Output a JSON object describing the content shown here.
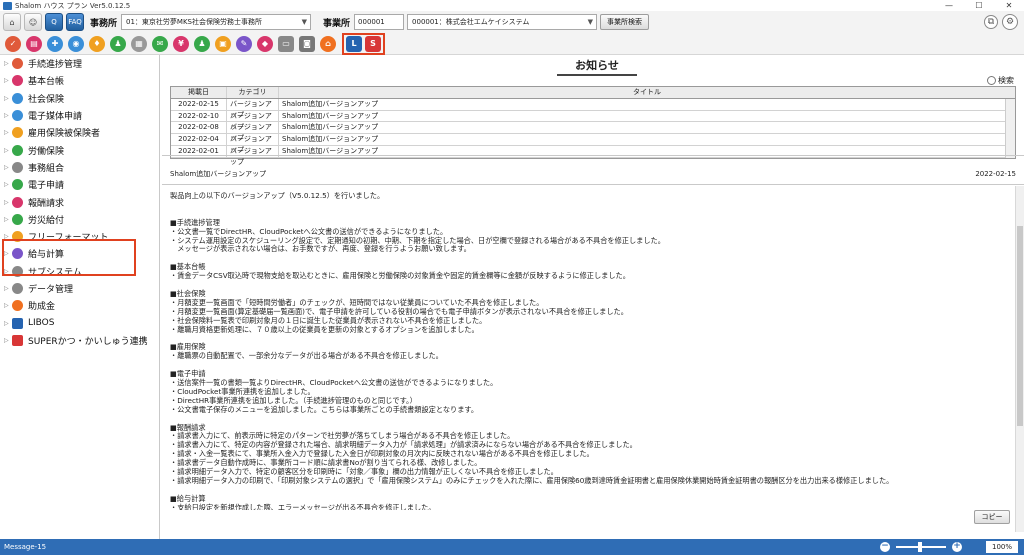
{
  "window": {
    "title": "Shalom ハウス プラン Ver5.0.12.5"
  },
  "toolbar": {
    "jimusho_label": "事務所",
    "jimusho_select": "01：東京社労夢MKS社会保険労務士事務所",
    "jigyosho_label": "事業所",
    "jigyosho_code": "000001",
    "jigyosho_select": "000001：株式会社エムケイシステム",
    "search_button": "事業所検索",
    "q_label": "Q",
    "faq_label": "FAQ"
  },
  "icon_toolbar": {
    "highlighted": [
      "L",
      "S"
    ]
  },
  "sidebar": {
    "items": [
      {
        "label": "手続進捗管理",
        "icon_color": "#e05a3a"
      },
      {
        "label": "基本台帳",
        "icon_color": "#d8366b"
      },
      {
        "label": "社会保険",
        "icon_color": "#3a8fd8"
      },
      {
        "label": "電子媒体申請",
        "icon_color": "#3a8fd8"
      },
      {
        "label": "雇用保険被保険者",
        "icon_color": "#f0a020"
      },
      {
        "label": "労働保険",
        "icon_color": "#37a84a"
      },
      {
        "label": "事務組合",
        "icon_color": "#888888"
      },
      {
        "label": "電子申請",
        "icon_color": "#37a84a"
      },
      {
        "label": "報酬請求",
        "icon_color": "#d8366b"
      },
      {
        "label": "労災給付",
        "icon_color": "#37a84a"
      },
      {
        "label": "フリーフォーマット",
        "icon_color": "#f0a020"
      },
      {
        "label": "給与計算",
        "icon_color": "#7a55c9"
      },
      {
        "label": "サブシステム",
        "icon_color": "#888888"
      },
      {
        "label": "データ管理",
        "icon_color": "#888888"
      },
      {
        "label": "助成金",
        "icon_color": "#f07020"
      },
      {
        "label": "LIBOS",
        "icon_color": "#2563b0"
      },
      {
        "label": "SUPERかつ・かいしゅう連携",
        "icon_color": "#d83636"
      }
    ]
  },
  "main": {
    "title": "お知らせ",
    "search_label": "検索",
    "table": {
      "headers": [
        "掲載日",
        "カテゴリ",
        "タイトル"
      ],
      "rows": [
        [
          "2022-02-15",
          "バージョンアップ",
          "Shalom追加バージョンアップ"
        ],
        [
          "2022-02-10",
          "バージョンアップ",
          "Shalom追加バージョンアップ"
        ],
        [
          "2022-02-08",
          "バージョンアップ",
          "Shalom追加バージョンアップ"
        ],
        [
          "2022-02-04",
          "バージョンアップ",
          "Shalom追加バージョンアップ"
        ],
        [
          "2022-02-01",
          "バージョンアップ",
          "Shalom追加バージョンアップ"
        ]
      ]
    },
    "detail": {
      "title": "Shalom追加バージョンアップ",
      "date": "2022-02-15",
      "body": "製品向上の以下のバージョンアップ（V5.0.12.5）を行いました。\n\n\n■手続進捗管理\n・公文書一覧でDirectHR、CloudPocketへ公文書の送信ができるようになりました。\n・システム運用設定のスケジューリング設定で、定期通知の初期、中期、下期を指定した場合、日が空欄で登録される場合がある不具合を修正しました。\n　メッセージが表示されない場合は、お手数ですが、再度、登録を行うようお願い致します。\n\n■基本台帳\n・賃金データCSV取込時で現物支給を取込むときに、雇用保険と労働保険の対象賃金や固定的賃金欄等に金額が反映するように修正しました。\n\n■社会保険\n・月額変更一覧画面で「短時間労働者」のチェックが、短時間ではない従業員についていた不具合を修正しました。\n・月額変更一覧画面(算定基礎届一覧画面)で、電子申請を許可している役割の場合でも電子申請ボタンが表示されない不具合を修正しました。\n・社会保険料一覧表で印刷対象月の１日に誕生した従業員が表示されない不具合を修正しました。\n・離職月資格更新処理に、７０歳以上の従業員を更新の対象とするオプションを追加しました。\n\n■雇用保険\n・離職票の自動配置で、一部余分なデータが出る場合がある不具合を修正しました。\n\n■電子申請\n・送信案件一覧の書類一覧よりDirectHR、CloudPocketへ公文書の送信ができるようになりました。\n・CloudPocket事業所連携を追加しました。\n・DirectHR事業所連携を追加しました。（手続進捗管理のものと同じです。）\n・公文書電子保存のメニューを追加しました。こちらは事業所ごとの手続書類設定となります。\n\n■報酬請求\n・請求書入力にて、前表示時に特定のパターンで社労夢が落ちてしまう場合がある不具合を修正しました。\n・請求書入力にて、特定の内容が登録された場合、請求明細データ入力が「請求処理」が請求済みにならない場合がある不具合を修正しました。\n・請求・入金一覧表にて、事業所入金入力で登録した入金日が印刷対象の月次内に反映されない場合がある不具合を修正しました。\n・請求書データ自動作成時に、事業所コード順に請求書Noが割り当てられる様、改修しました。\n・請求明細データ入力で、特定の顧客区分を印刷時に「対象／事象」欄の出力情報が正しくない不具合を修正しました。\n・請求明細データ入力の印刷で、「印刷対象システムの選択」で「雇用保険システム」のみにチェックを入れた際に、雇用保険60歳到達時賃金証明書と雇用保険休業開始時賃金証明書の報酬区分を出力出来る様修正しました。\n\n■給与計算\n・支給日設定を新規作成した際、エラーメッセージが出る不具合を修正しました。\n・社員支給控除金額入力について、マイナスの値を入力できるようにしました。\n・源泉徴収票印刷画面の従業員検索ボタンの従業員コード指定から従業員を選択するとき、選択した従業員が出力されない不具合を修正しました。",
      "copy_button": "コピー"
    }
  },
  "statusbar": {
    "message": "Message-15",
    "zoom": "100%"
  }
}
